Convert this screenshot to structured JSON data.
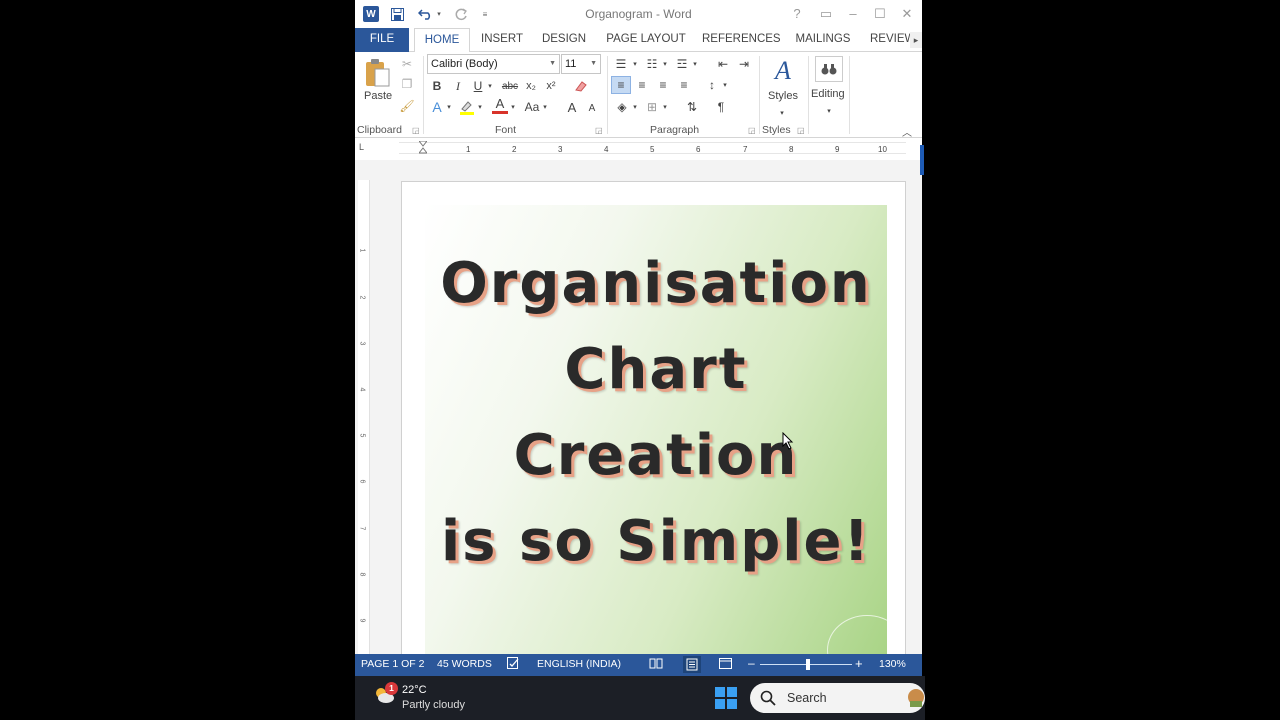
{
  "app": {
    "title": "Organogram - Word"
  },
  "quick_access": {
    "save_icon": "save-icon",
    "undo_icon": "undo-icon",
    "redo_icon": "redo-icon",
    "customize_icon": "customize-icon"
  },
  "window_controls": {
    "help": "?",
    "ribbon_display": "▭",
    "minimize": "–",
    "maximize": "☐",
    "close": "✕"
  },
  "tabs": [
    {
      "label": "FILE"
    },
    {
      "label": "HOME"
    },
    {
      "label": "INSERT"
    },
    {
      "label": "DESIGN"
    },
    {
      "label": "PAGE LAYOUT"
    },
    {
      "label": "REFERENCES"
    },
    {
      "label": "MAILINGS"
    },
    {
      "label": "REVIEW"
    }
  ],
  "ribbon": {
    "clipboard": {
      "label": "Clipboard",
      "paste_label": "Paste"
    },
    "font": {
      "label": "Font",
      "font_name": "Calibri (Body)",
      "font_size": "11",
      "bold": "B",
      "italic": "I",
      "underline": "U",
      "strike": "abc",
      "subscript": "x₂",
      "superscript": "x²",
      "grow": "A",
      "shrink": "A",
      "change_case": "Aa"
    },
    "paragraph": {
      "label": "Paragraph",
      "pilcrow": "¶"
    },
    "styles": {
      "label": "Styles",
      "button_label": "Styles"
    },
    "editing": {
      "button_label": "Editing"
    }
  },
  "ruler": {
    "marker": "L",
    "numbers": [
      "1",
      "2",
      "3",
      "4",
      "5",
      "6",
      "7",
      "8",
      "9",
      "10"
    ],
    "vertical_numbers": [
      "1",
      "2",
      "3",
      "4",
      "5",
      "6",
      "7",
      "8",
      "9"
    ]
  },
  "document": {
    "cover_lines": [
      "Organisation",
      "Chart",
      "Creation",
      "is so Simple!"
    ]
  },
  "status_bar": {
    "page": "PAGE 1 OF 2",
    "words": "45 WORDS",
    "language": "ENGLISH (INDIA)",
    "zoom_minus": "–",
    "zoom_plus": "+",
    "zoom": "130%"
  },
  "taskbar": {
    "weather_badge": "1",
    "temperature": "22°C",
    "condition": "Partly cloudy",
    "search_label": "Search"
  },
  "colors": {
    "accent": "#2b579a",
    "taskbar": "#1c1f26",
    "text_shadow": "#e7a287"
  }
}
